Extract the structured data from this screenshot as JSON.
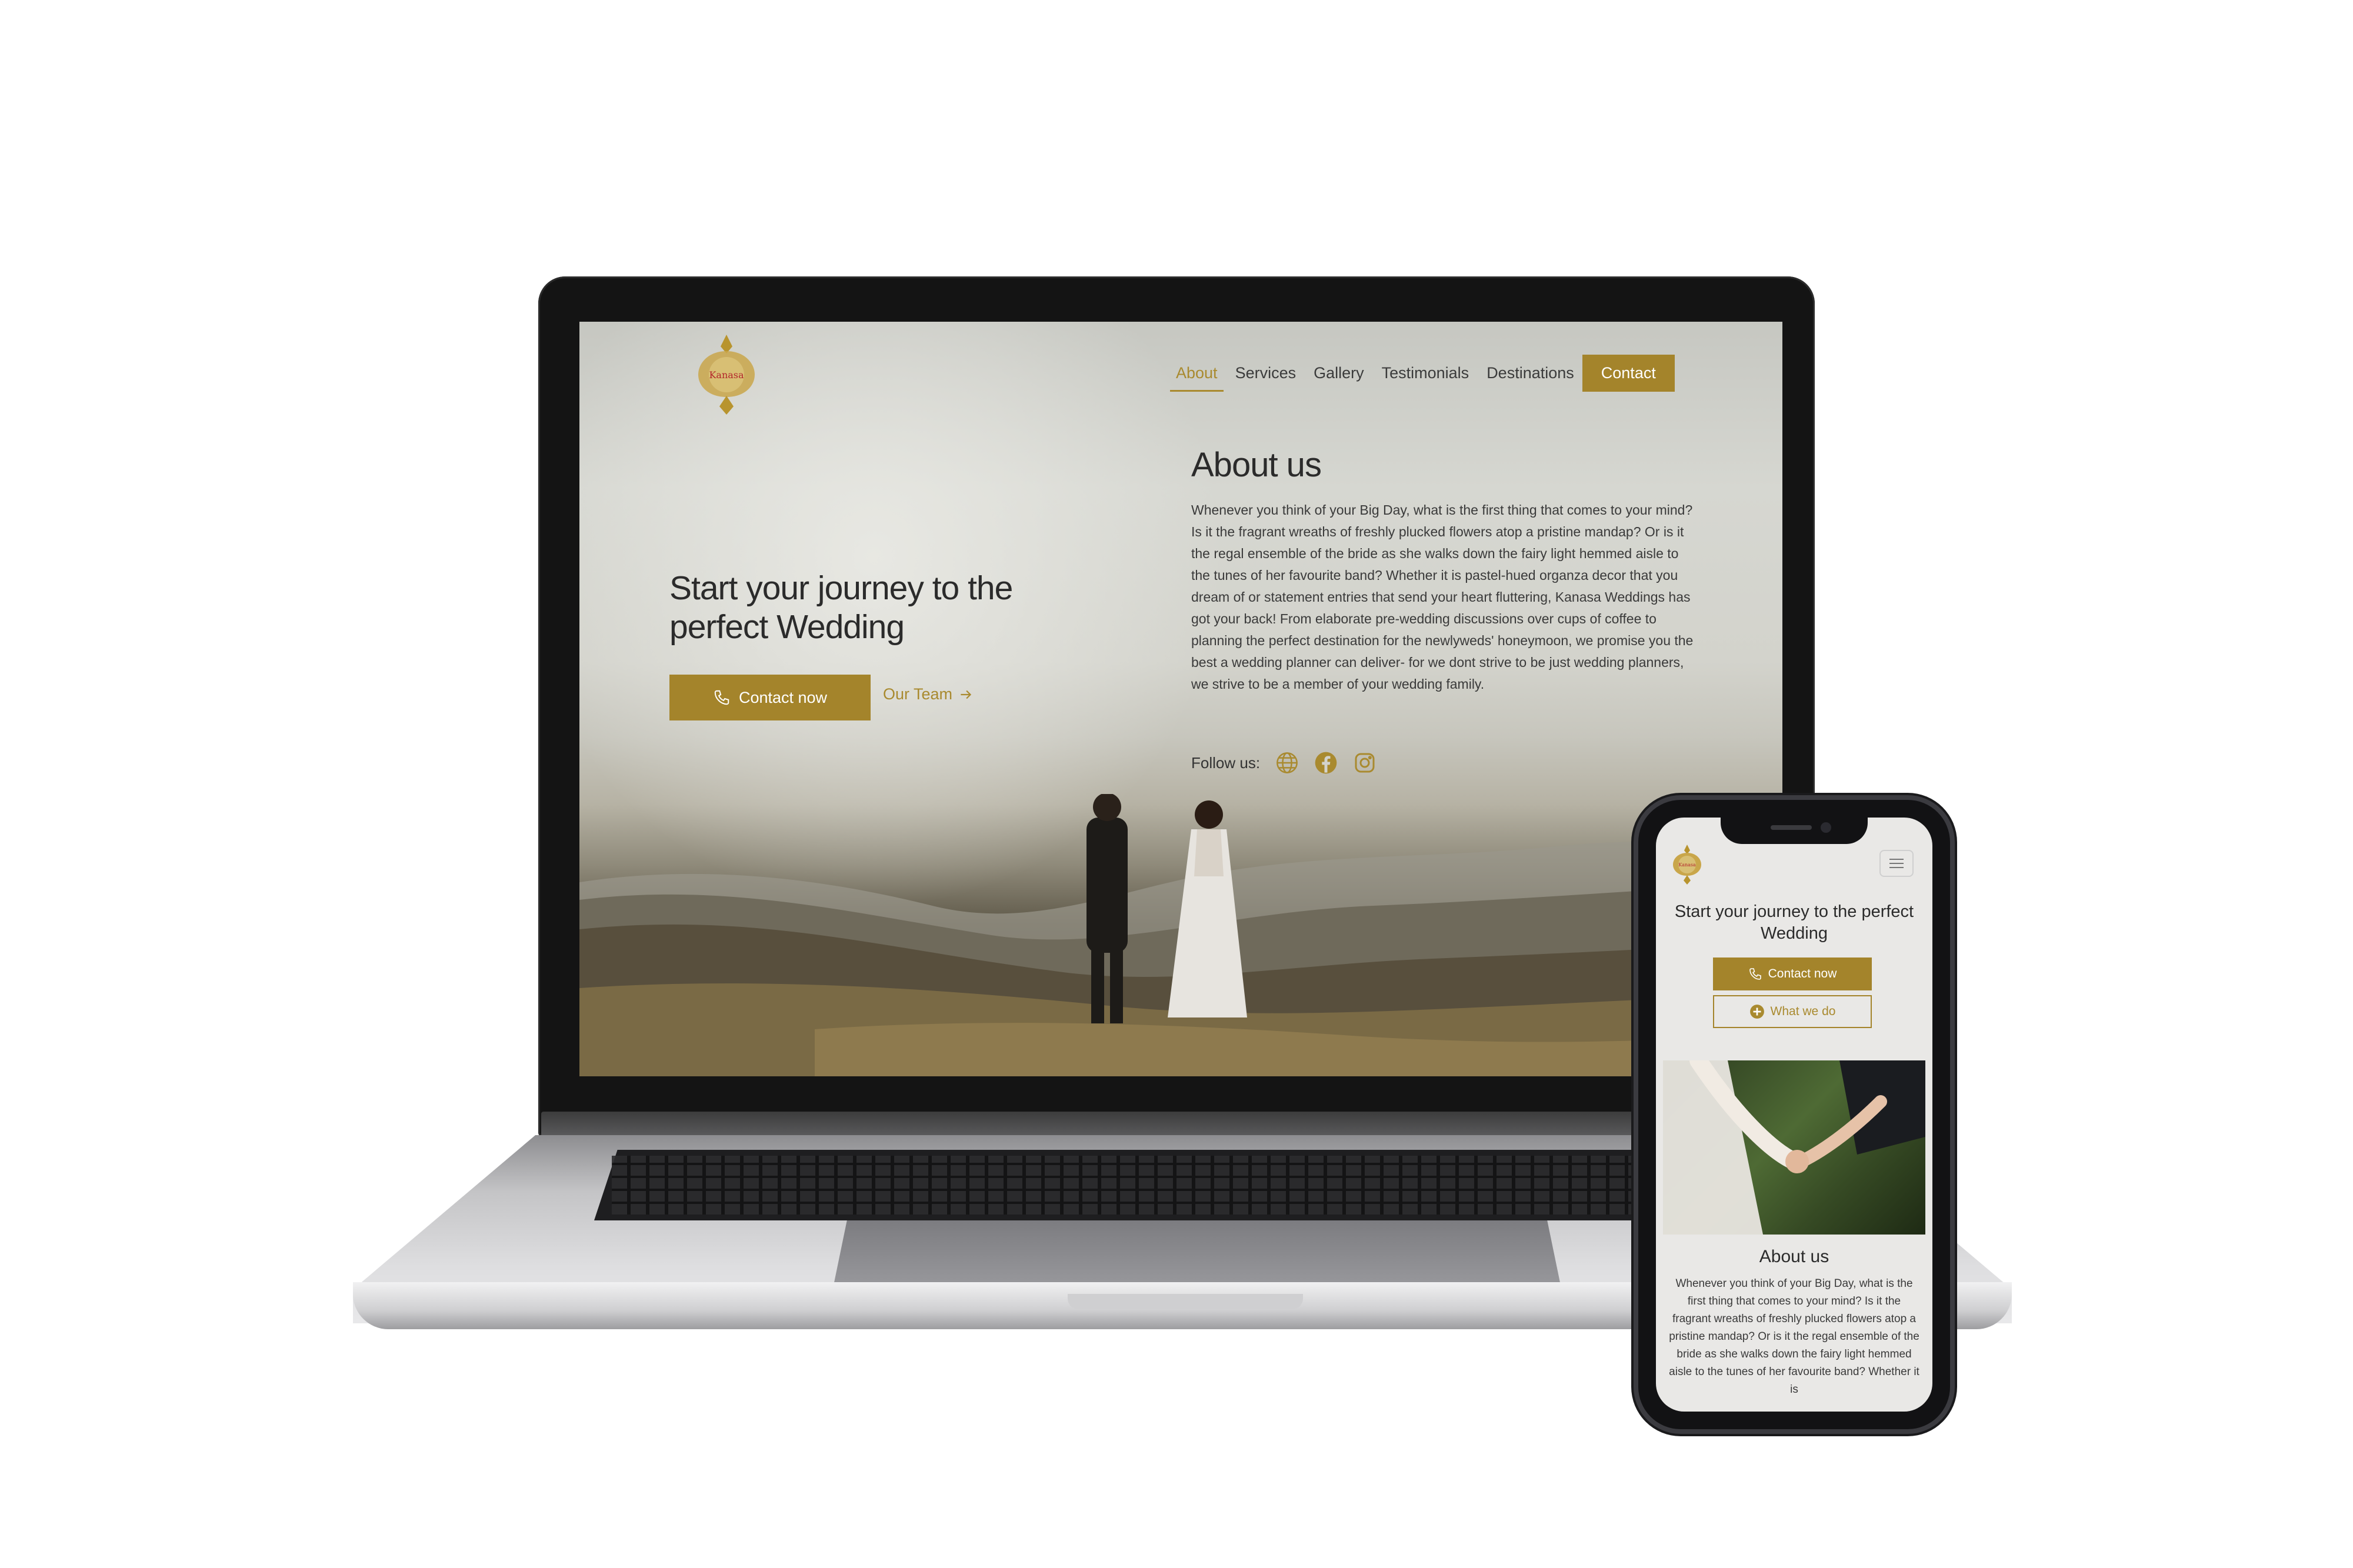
{
  "laptop": {
    "logo_text": "Kanasa",
    "nav": {
      "items": [
        {
          "label": "About",
          "active": true
        },
        {
          "label": "Services",
          "active": false
        },
        {
          "label": "Gallery",
          "active": false
        },
        {
          "label": "Testimonials",
          "active": false
        },
        {
          "label": "Destinations",
          "active": false
        }
      ],
      "contact_label": "Contact"
    },
    "hero": {
      "title": "Start your journey to the perfect Wedding",
      "primary_button": "Contact now",
      "secondary_link": "Our Team"
    },
    "about": {
      "title": "About us",
      "text": "Whenever you think of your Big Day, what is the first thing that comes to your mind? Is it the fragrant wreaths of freshly plucked flowers atop a pristine mandap? Or is it the regal ensemble of the bride as she walks down the fairy light hemmed aisle to the tunes of her favourite band? Whether it is pastel-hued organza decor that you dream of or statement entries that send your heart fluttering, Kanasa Weddings has got your back! From elaborate pre-wedding discussions over cups of coffee to planning the perfect destination for the newlyweds' honeymoon, we promise you the best a wedding planner can deliver- for we dont strive to be just wedding planners, we strive to be a member of your wedding family.",
      "follow_label": "Follow us:",
      "social_icons": [
        "globe-icon",
        "facebook-icon",
        "instagram-icon"
      ]
    }
  },
  "phone": {
    "logo_text": "Kanasa",
    "hero": {
      "title": "Start your journey to the perfect Wedding",
      "primary_button": "Contact now",
      "secondary_button": "What we do"
    },
    "about": {
      "title": "About us",
      "text": "Whenever you think of your Big Day, what is the first thing that comes to your mind? Is it the fragrant wreaths of freshly plucked flowers atop a pristine mandap? Or is it the regal ensemble of the bride as she walks down the fairy light hemmed aisle to the tunes of her favourite band? Whether it is"
    }
  },
  "colors": {
    "accent": "#a4842b",
    "accent_text": "#a98a2f",
    "text_dark": "#2b2b2b",
    "logo_red": "#b3262b"
  }
}
